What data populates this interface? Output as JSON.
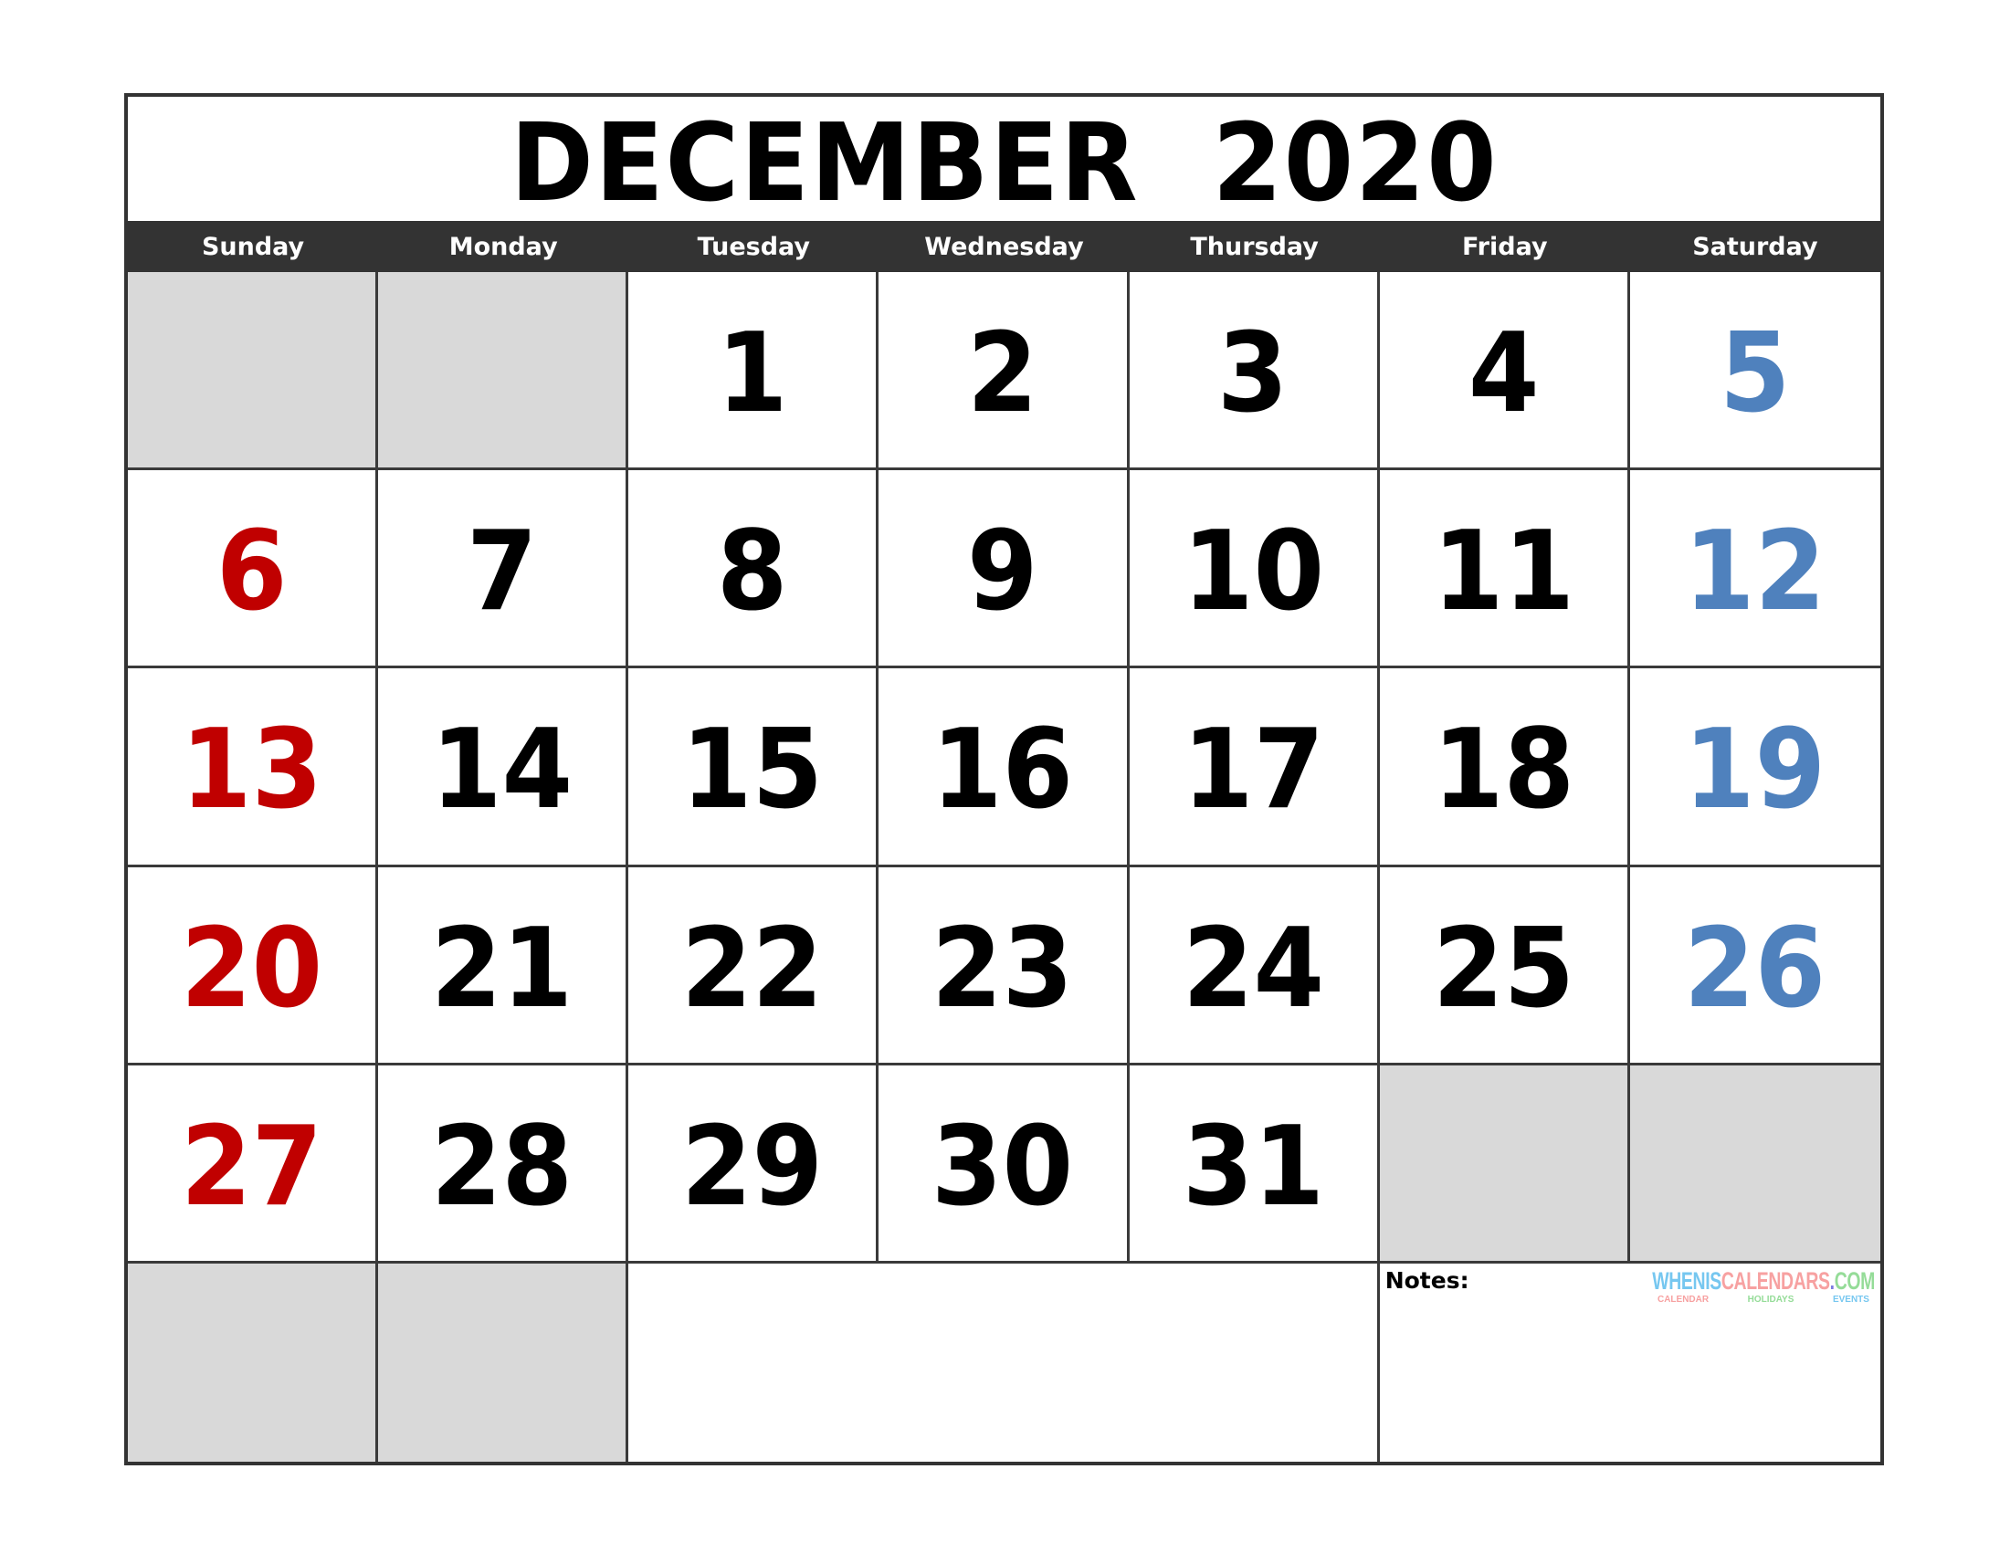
{
  "calendar": {
    "title": "DECEMBER  2020",
    "month": "December",
    "year": 2020,
    "weekdays": [
      "Sunday",
      "Monday",
      "Tuesday",
      "Wednesday",
      "Thursday",
      "Friday",
      "Saturday"
    ],
    "weeks": [
      [
        null,
        null,
        1,
        2,
        3,
        4,
        5
      ],
      [
        6,
        7,
        8,
        9,
        10,
        11,
        12
      ],
      [
        13,
        14,
        15,
        16,
        17,
        18,
        19
      ],
      [
        20,
        21,
        22,
        23,
        24,
        25,
        26
      ],
      [
        27,
        28,
        29,
        30,
        31,
        null,
        null
      ]
    ],
    "colors": {
      "sunday": "#c00000",
      "saturday": "#4f81bd",
      "weekday": "#000000",
      "header_band": "#333333",
      "empty_cell": "#d9d9d9"
    }
  },
  "notes": {
    "label": "Notes:"
  },
  "logo": {
    "parts": [
      {
        "text": "WHENIS",
        "color": "#76c7f0"
      },
      {
        "text": "CALENDARS",
        "color": "#f7a1a1"
      },
      {
        "text": ".",
        "color": "#7b7be0"
      },
      {
        "text": "COM",
        "color": "#95dc98"
      }
    ],
    "taglines": [
      {
        "text": "CALENDAR",
        "color": "#f7a1a1"
      },
      {
        "text": "HOLIDAYS",
        "color": "#95dc98"
      },
      {
        "text": "EVENTS",
        "color": "#76c7f0"
      }
    ]
  }
}
